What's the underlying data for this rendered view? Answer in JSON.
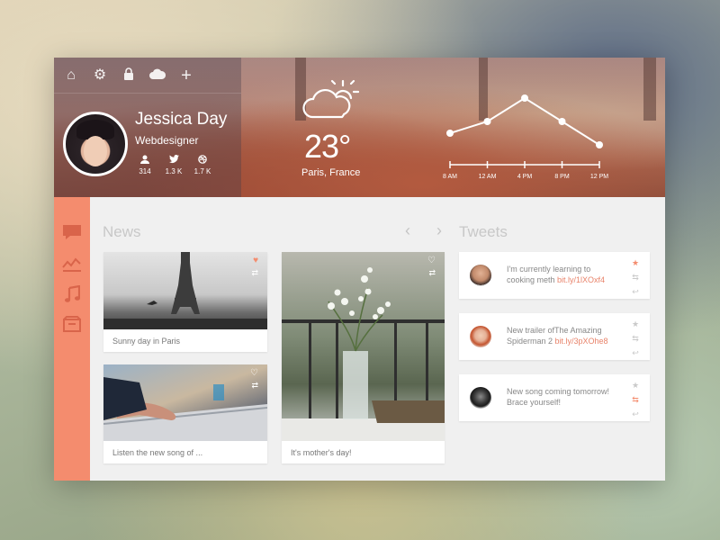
{
  "nav": {
    "icons": [
      "home-icon",
      "gear-icon",
      "lock-icon",
      "cloud-icon",
      "plus-icon"
    ]
  },
  "profile": {
    "name": "Jessica Day",
    "role": "Webdesigner",
    "stats": [
      {
        "icon": "user-icon",
        "value": "314"
      },
      {
        "icon": "twitter-icon",
        "value": "1.3 K"
      },
      {
        "icon": "dribbble-icon",
        "value": "1.7 K"
      }
    ]
  },
  "weather": {
    "icon": "partly-cloudy-icon",
    "temp": "23°",
    "city": "Paris, France"
  },
  "chart_data": {
    "type": "line",
    "categories": [
      "8 AM",
      "12 AM",
      "4 PM",
      "8 PM",
      "12 PM"
    ],
    "values": [
      2,
      3,
      5,
      3,
      1
    ],
    "ylim": [
      0,
      6
    ],
    "grid": false,
    "title": "",
    "xlabel": "",
    "ylabel": ""
  },
  "sidebar": {
    "icons": [
      "chat-icon",
      "activity-icon",
      "music-icon",
      "inbox-icon"
    ]
  },
  "news": {
    "title": "News",
    "prev_label": "‹",
    "next_label": "›",
    "cards": [
      {
        "caption": "Sunny day in Paris",
        "liked": true
      },
      {
        "caption": "Listen the new song of ...",
        "liked": false
      },
      {
        "caption": "It's mother's day!",
        "liked": false
      }
    ]
  },
  "tweets": {
    "title": "Tweets",
    "items": [
      {
        "text": "I'm currently learning to cooking meth ",
        "link": "bit.ly/1lXOxf4",
        "starred": true,
        "retweeted": false
      },
      {
        "text": "New trailer ofThe Amazing Spiderman 2 ",
        "link": "bit.ly/3pXOhe8",
        "starred": false,
        "retweeted": false
      },
      {
        "text": "New song coming tomorrow! Brace yourself!",
        "link": "",
        "starred": false,
        "retweeted": true
      }
    ]
  },
  "colors": {
    "accent": "#f48c6e",
    "link": "#e8836a",
    "background": "#f0f0f0"
  }
}
